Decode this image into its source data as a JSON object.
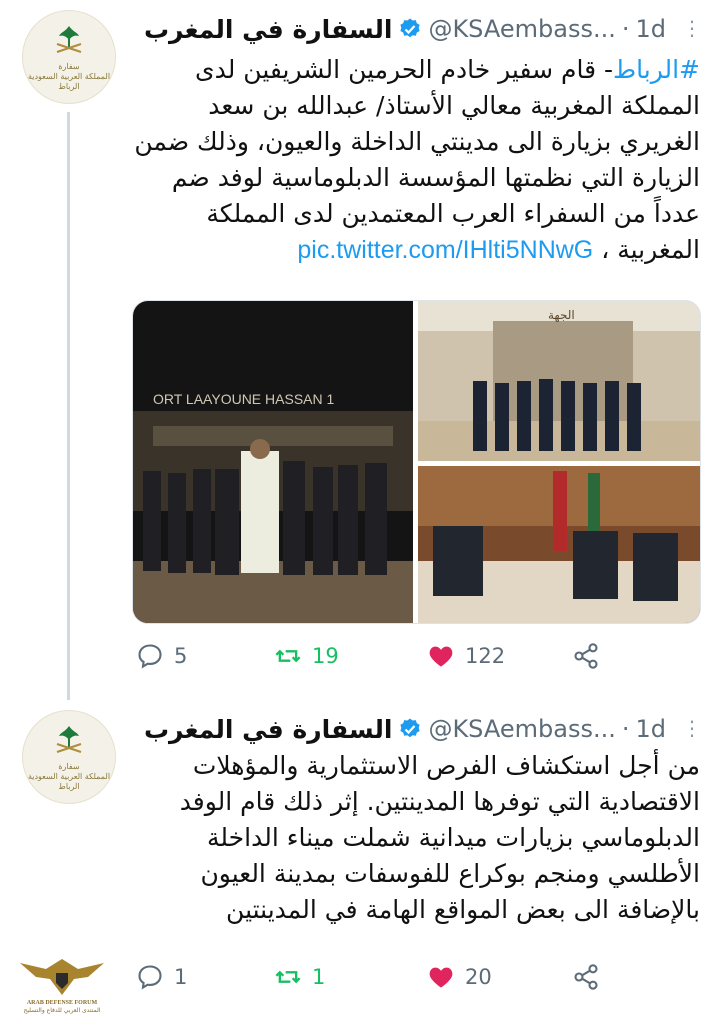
{
  "account": {
    "display_name": "السفارة في المغرب",
    "handle": "@KSAembass...",
    "avatar_text": [
      "سفارة",
      "المملكة العربية السعودية",
      "الرباط"
    ]
  },
  "tweets": [
    {
      "time": "1d",
      "hashtag": "#الرباط",
      "text": "- قام سفير خادم الحرمين الشريفين لدى المملكة المغربية معالي الأستاذ/ عبدالله بن سعد الغريري بزيارة الى مدينتي الداخلة والعيون، وذلك ضمن الزيارة التي نظمتها المؤسسة الدبلوماسية لوفد ضم عدداً من السفراء العرب المعتمدين لدى المملكة المغربية ، ",
      "link": "pic.twitter.com/IHlti5NNwG",
      "media": {
        "photo1_sign": "ORT LAAYOUNE HASSAN 1",
        "photo2_sign": "الجهة"
      },
      "replies": "5",
      "retweets": "19",
      "likes": "122"
    },
    {
      "time": "1d",
      "text": "من أجل استكشاف الفرص الاستثمارية والمؤهلات الاقتصادية التي توفرها المدينتين. إثر ذلك قام الوفد الدبلوماسي بزيارات ميدانية شملت ميناء الداخلة الأطلسي ومنجم بوكراع للفوسفات بمدينة العيون بالإضافة الى بعض المواقع الهامة في المدينتين",
      "replies": "1",
      "retweets": "1",
      "likes": "20"
    }
  ],
  "watermark": {
    "line1": "ARAB DEFENSE FORUM",
    "line2": "المنتدى العربي للدفاع والتسليح"
  },
  "colors": {
    "link": "#1d9bf0",
    "retweet": "#17bf63",
    "like": "#e0245e",
    "muted": "#5b6b78",
    "thread_line": "#cfd9de"
  }
}
